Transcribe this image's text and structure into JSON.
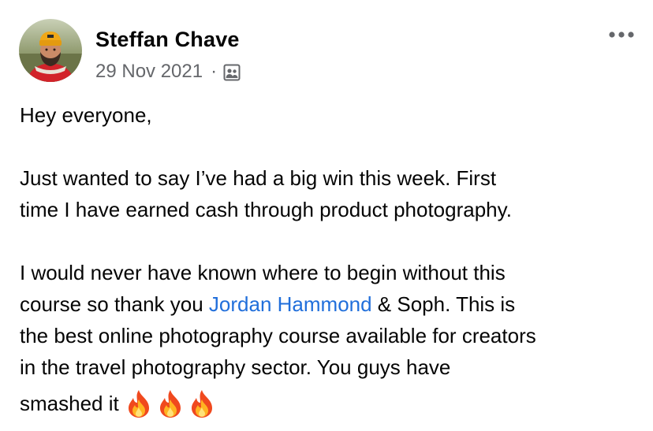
{
  "post": {
    "author_name": "Steffan Chave",
    "date": "29 Nov 2021",
    "separator": "·",
    "audience_icon": "group-members-icon",
    "more_icon": "more-options-icon",
    "body": {
      "greeting": "Hey everyone,",
      "para2_line1": "Just wanted to say I’ve had a big win this week. First",
      "para2_line2": "time I have earned cash through product photography.",
      "para3_line1": "I would never have known where to begin without this",
      "para3_line2_before": "course so thank you ",
      "mention": "Jordan Hammond",
      "para3_line2_after": " & Soph. This is",
      "para3_line3": "the best online photography course available for creators",
      "para3_line4": "in the travel photography sector. You guys have",
      "para3_line5": "smashed it"
    },
    "emojis": [
      "fire-icon",
      "fire-icon",
      "fire-icon"
    ],
    "colors": {
      "mention": "#216fdb",
      "meta_text": "#65676b",
      "text": "#050505"
    }
  }
}
